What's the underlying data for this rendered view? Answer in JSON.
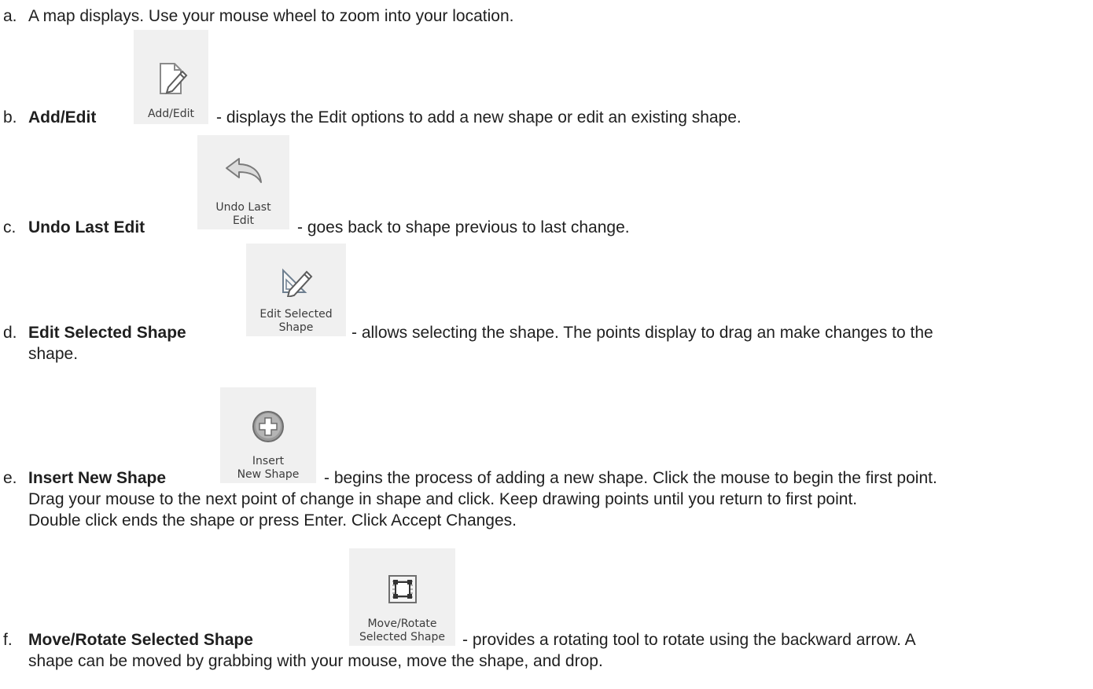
{
  "items": [
    {
      "marker": "a.",
      "lead": "A map displays. Use your mouse wheel to zoom into your location."
    },
    {
      "marker": "b.",
      "title": "Add/Edit",
      "desc": "- displays the Edit options to add a new shape or edit an existing shape.",
      "button": {
        "label_lines": [
          "Add/Edit"
        ],
        "icon": "page-pencil-icon"
      }
    },
    {
      "marker": "c.",
      "title": "Undo Last Edit",
      "desc": "- goes back to shape previous to last change.",
      "button": {
        "label_lines": [
          "Undo Last",
          "Edit"
        ],
        "icon": "undo-arrow-icon"
      }
    },
    {
      "marker": "d.",
      "title": "Edit Selected Shape",
      "desc": "- allows selecting the shape. The points display to drag an make changes to the",
      "desc_cont": [
        "shape."
      ],
      "button": {
        "label_lines": [
          "Edit Selected",
          "Shape"
        ],
        "icon": "triangle-pencil-icon"
      }
    },
    {
      "marker": "e.",
      "title": "Insert New Shape",
      "desc": "- begins the process of adding a new shape. Click the mouse to begin the first point.",
      "desc_cont": [
        "Drag your mouse to the next point of change in shape and click. Keep drawing points until you return to first point.",
        "Double click ends the shape or press Enter. Click Accept Changes."
      ],
      "button": {
        "label_lines": [
          "Insert",
          "New Shape"
        ],
        "icon": "plus-circle-icon"
      }
    },
    {
      "marker": "f.",
      "title": "Move/Rotate Selected Shape",
      "desc": "- provides a rotating tool to rotate using the backward arrow. A",
      "desc_cont": [
        "shape can be moved by grabbing with your mouse, move the shape, and drop."
      ],
      "button": {
        "label_lines": [
          "Move/Rotate",
          "Selected Shape"
        ],
        "icon": "select-frame-icon"
      }
    }
  ],
  "colors": {
    "button_bg": "#f0f0f0",
    "text": "#1f1f1f",
    "icon_gray": "#7a7a7a"
  }
}
